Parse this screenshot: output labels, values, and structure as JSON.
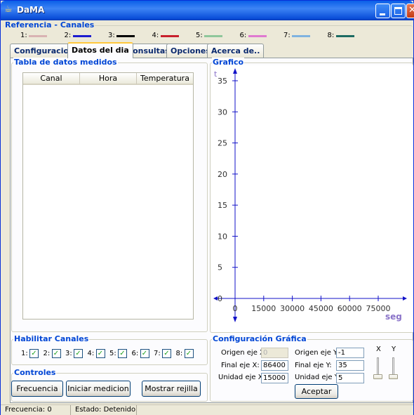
{
  "window": {
    "title": "DaMA"
  },
  "references": {
    "group_title": "Referencia - Canales",
    "channels": [
      {
        "label": "1:",
        "color": "#d9b3b3"
      },
      {
        "label": "2:",
        "color": "#1c1ccf"
      },
      {
        "label": "3:",
        "color": "#000000"
      },
      {
        "label": "4:",
        "color": "#c8202c"
      },
      {
        "label": "5:",
        "color": "#8fc79b"
      },
      {
        "label": "6:",
        "color": "#e07ad0"
      },
      {
        "label": "7:",
        "color": "#7fb3e0"
      },
      {
        "label": "8:",
        "color": "#1c6b62"
      }
    ]
  },
  "tabs": [
    {
      "label": "Configuracion"
    },
    {
      "label": "Datos del dia",
      "active": true
    },
    {
      "label": "Consultas"
    },
    {
      "label": "Opciones"
    },
    {
      "label": "Acerca de.."
    }
  ],
  "table": {
    "group_title": "Tabla de datos medidos",
    "columns": [
      "Canal",
      "Hora",
      "Temperatura"
    ],
    "rows": []
  },
  "chart": {
    "group_title": "Grafico",
    "y_label": "t",
    "x_label": "seg",
    "y_ticks": [
      "35",
      "30",
      "25",
      "20",
      "15",
      "10",
      "5",
      "0"
    ],
    "x_ticks": [
      "0",
      "15000",
      "30000",
      "45000",
      "60000",
      "75000"
    ]
  },
  "chart_data": {
    "type": "line",
    "xlabel": "seg",
    "ylabel": "t",
    "xlim": [
      0,
      86400
    ],
    "ylim": [
      -1,
      35
    ],
    "x_ticks": [
      0,
      15000,
      30000,
      45000,
      60000,
      75000
    ],
    "y_ticks": [
      0,
      5,
      10,
      15,
      20,
      25,
      30,
      35
    ],
    "series": [],
    "grid": false
  },
  "channels_enable": {
    "group_title": "Habilitar Canales",
    "items": [
      {
        "label": "1:",
        "checked": true
      },
      {
        "label": "2:",
        "checked": true
      },
      {
        "label": "3:",
        "checked": true
      },
      {
        "label": "4:",
        "checked": true
      },
      {
        "label": "5:",
        "checked": true
      },
      {
        "label": "6:",
        "checked": true
      },
      {
        "label": "7:",
        "checked": true
      },
      {
        "label": "8:",
        "checked": true
      }
    ],
    "check_glyph": "✓"
  },
  "controls": {
    "group_title": "Controles",
    "frequency_button": "Frecuencia",
    "start_button": "Iniciar medicion",
    "grid_button": "Mostrar rejilla"
  },
  "chart_config": {
    "group_title": "Configuración Gráfica",
    "origin_x_label": "Origen eje X:",
    "origin_x_value": "0",
    "end_x_label": "Final eje X:",
    "end_x_value": "86400",
    "unit_x_label": "Unidad eje X:",
    "unit_x_value": "15000",
    "origin_y_label": "Origen eje Y:",
    "origin_y_value": "-1",
    "end_y_label": "Final eje Y:",
    "end_y_value": "35",
    "unit_y_label": "Unidad eje Y:",
    "unit_y_value": "5",
    "accept_button": "Aceptar",
    "slider_x_label": "X",
    "slider_y_label": "Y",
    "slider_x_level": 0,
    "slider_y_level": 0
  },
  "statusbar": {
    "frequency": "Frecuencia: 0",
    "state": "Estado: Detenido"
  }
}
